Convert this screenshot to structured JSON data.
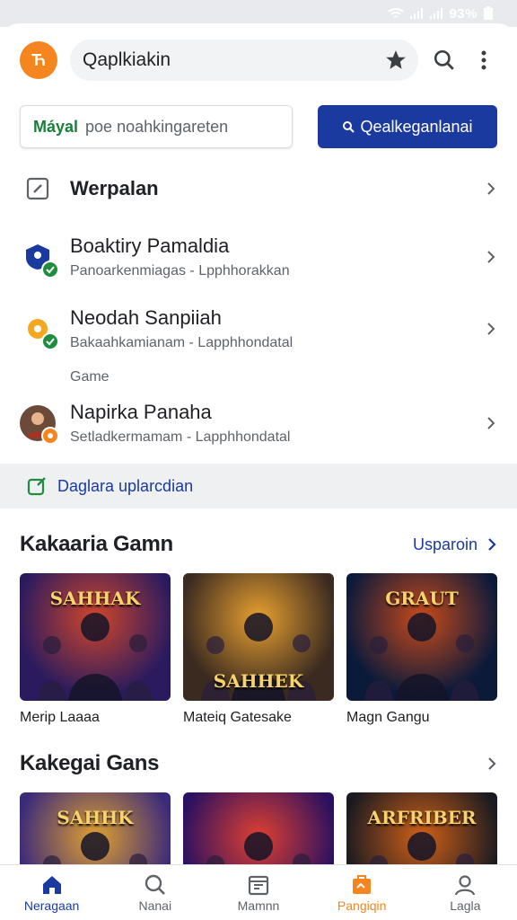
{
  "status": {
    "text": "93%"
  },
  "header": {
    "logo_text": "Ћ",
    "search_value": "Qaplkiakin"
  },
  "chips": {
    "left_bold": "Máyal",
    "left_text": "poe noahkingareten",
    "right_text": "Qealkeganlanai"
  },
  "list": [
    {
      "title": "Werpalan",
      "subtitle": ""
    },
    {
      "title": "Boaktiry Pamaldia",
      "subtitle": "Panoarkenmiagas - Lpphhorakkan"
    },
    {
      "title": "Neodah Sanpiiah",
      "subtitle": "Bakaahkamianam - Lapphhondatal"
    },
    {
      "title": "Napirka Panaha",
      "subtitle": "Setladkermamam - Lapphhondatal"
    }
  ],
  "section_label": "Game",
  "banner": {
    "text": "Daglara uplarcdian"
  },
  "section1": {
    "title": "Kakaaria Gamn",
    "action": "Usparoin",
    "cards": [
      {
        "caption": "Merip Laaaa",
        "thumb_text": "SAHHAK",
        "colors": [
          "#2b1b5e",
          "#d0452a"
        ]
      },
      {
        "caption": "Mateiq Gatesake",
        "thumb_text": "SAHHEK",
        "colors": [
          "#3a2a20",
          "#e8a030"
        ]
      },
      {
        "caption": "Magn Gangu",
        "thumb_text": "GRAUT",
        "colors": [
          "#0c1a3a",
          "#c84a1a"
        ]
      }
    ]
  },
  "section2": {
    "title": "Kakegai Gans",
    "cards": [
      {
        "thumb_text": "SAHHK",
        "colors": [
          "#3b2a7a",
          "#e0a030"
        ]
      },
      {
        "thumb_text": "",
        "colors": [
          "#2a1060",
          "#e04030"
        ]
      },
      {
        "thumb_text": "ARFRIBER",
        "colors": [
          "#1a1a20",
          "#d06018"
        ]
      }
    ]
  },
  "nav": [
    {
      "label": "Neragaan",
      "icon": "home-icon"
    },
    {
      "label": "Nanai",
      "icon": "search-icon"
    },
    {
      "label": "Mamnn",
      "icon": "calendar-icon"
    },
    {
      "label": "Pangiqin",
      "icon": "store-icon"
    },
    {
      "label": "Lagla",
      "icon": "profile-icon"
    }
  ]
}
